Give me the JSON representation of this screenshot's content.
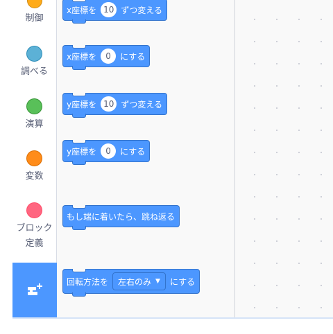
{
  "categories": [
    {
      "label": "制御",
      "color": "#ffab19"
    },
    {
      "label": "調べる",
      "color": "#5cb1d6"
    },
    {
      "label": "演算",
      "color": "#59c059"
    },
    {
      "label": "変数",
      "color": "#ff8c1a"
    },
    {
      "label": "ブロック定義",
      "color": "#ff6680"
    }
  ],
  "extension_button": {
    "icon": "add-extension-icon",
    "color": "#4c97ff"
  },
  "blocks": {
    "change_x": {
      "prefix": "x座標を",
      "value": "10",
      "suffix": "ずつ変える"
    },
    "set_x": {
      "prefix": "x座標を",
      "value": "0",
      "suffix": "にする"
    },
    "change_y": {
      "prefix": "y座標を",
      "value": "10",
      "suffix": "ずつ変える"
    },
    "set_y": {
      "prefix": "y座標を",
      "value": "0",
      "suffix": "にする"
    },
    "bounce": {
      "label": "もし端に着いたら、跳ね返る"
    },
    "rotation_style": {
      "prefix": "回転方法を",
      "selected": "左右のみ",
      "caret": "▼",
      "suffix": "にする"
    }
  },
  "colors": {
    "motion_block": "#4c97ff",
    "motion_border": "#3373cc",
    "sidebar_text": "#575e75"
  }
}
